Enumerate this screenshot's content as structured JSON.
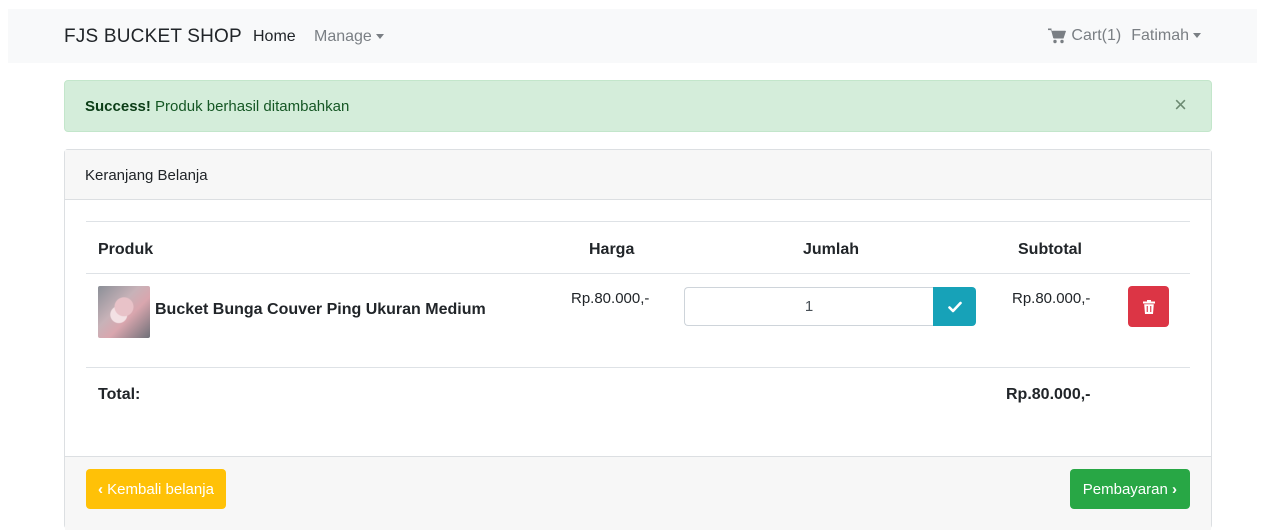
{
  "navbar": {
    "brand": "FJS BUCKET SHOP",
    "home": "Home",
    "manage": "Manage",
    "cart": "Cart(1)",
    "user": "Fatimah"
  },
  "alert": {
    "strong": "Success!",
    "message": " Produk berhasil ditambahkan",
    "close": "×"
  },
  "cart": {
    "title": "Keranjang Belanja",
    "columns": [
      "Produk",
      "Harga",
      "Jumlah",
      "Subtotal"
    ],
    "items": [
      {
        "name": "Bucket Bunga Couver Ping Ukuran Medium",
        "price": "Rp.80.000,-",
        "qty": "1",
        "subtotal": "Rp.80.000,-"
      }
    ],
    "total_label": "Total:",
    "total_value": "Rp.80.000,-"
  },
  "footer": {
    "back_label": "Kembali belanja",
    "back_chevron": "‹",
    "pay_label": "Pembayaran",
    "pay_chevron": "›"
  },
  "colors": {
    "success_bg": "#d4edda",
    "info": "#17a2b8",
    "danger": "#dc3545",
    "warning": "#ffc107",
    "primary_green": "#28a745"
  },
  "icons": {
    "cart": "shopping-cart-icon",
    "check": "check-icon",
    "trash": "trash-icon"
  }
}
